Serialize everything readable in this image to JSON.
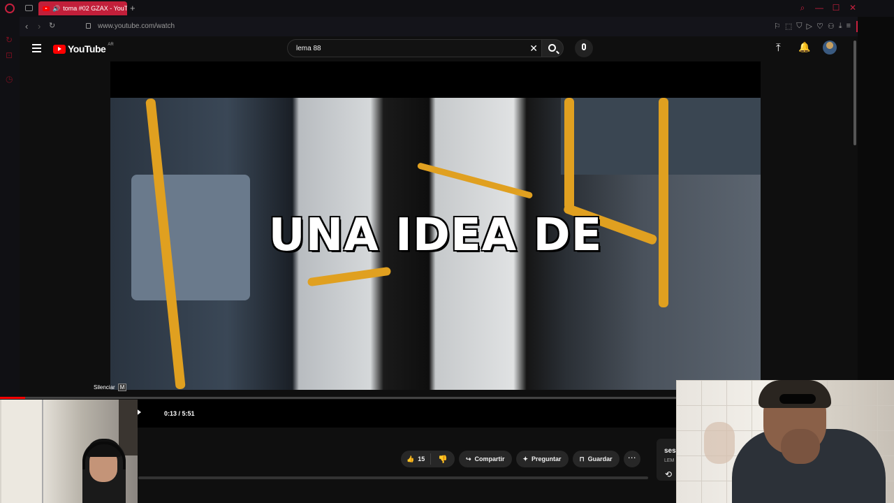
{
  "browser": {
    "tab_title": "toma #02 GZAX - YouT",
    "new_tab": "+",
    "url": "www.youtube.com/watch"
  },
  "youtube": {
    "logo_text": "YouTube",
    "country_code": "AR",
    "search_value": "lema 88"
  },
  "video": {
    "overlay_text": "UNA IDEA DE",
    "mute_tooltip": "Silenciar",
    "mute_key": "M",
    "time_display": "0:13 / 5:51",
    "progress_fraction": 0.037
  },
  "actions": {
    "like_count": "15",
    "share_label": "Compartir",
    "ask_label": "Preguntar",
    "save_label": "Guardar"
  },
  "side_card": {
    "title_fragment": "ses",
    "sub_fragment": "LEM"
  },
  "colors": {
    "browser_accent": "#c8203e",
    "youtube_red": "#ff0000",
    "pole_yellow": "#e0a020"
  }
}
